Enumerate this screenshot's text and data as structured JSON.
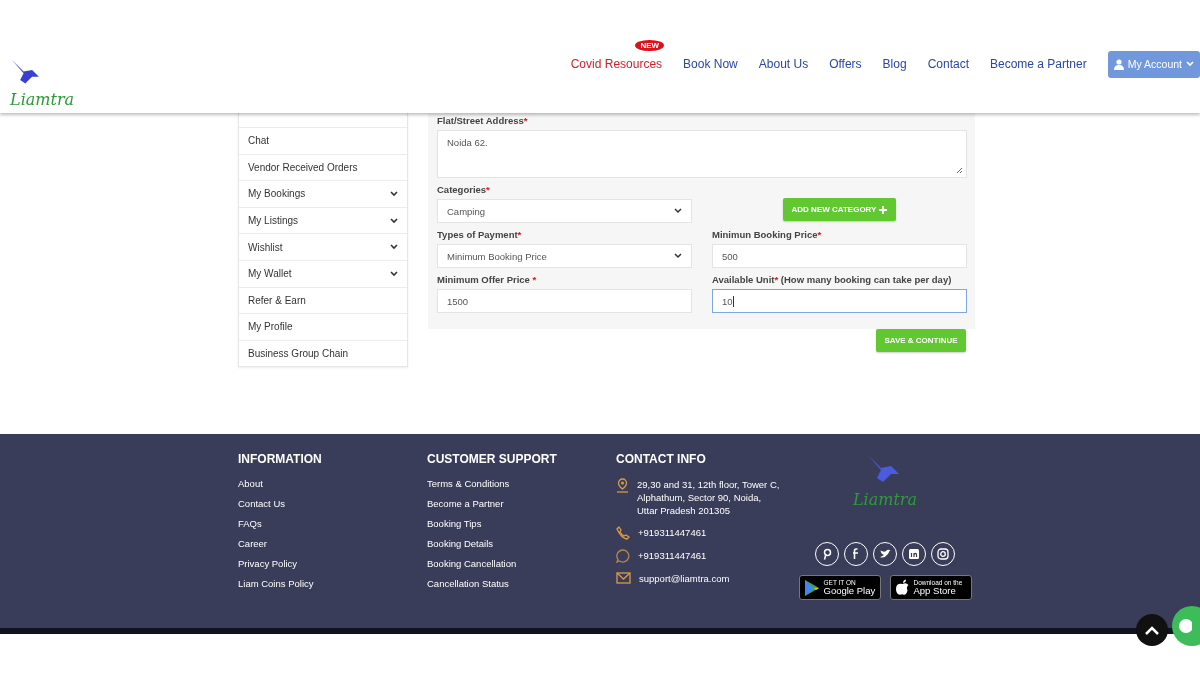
{
  "header": {
    "logo": "Liamtra",
    "nav": [
      {
        "label": "Covid Resources",
        "badge": "NEW",
        "kind": "highlight"
      },
      {
        "label": "Book Now",
        "kind": "link"
      },
      {
        "label": "About Us",
        "kind": "link"
      },
      {
        "label": "Offers",
        "kind": "link"
      },
      {
        "label": "Blog",
        "kind": "link"
      },
      {
        "label": "Contact",
        "kind": "link"
      },
      {
        "label": "Become a Partner",
        "kind": "link"
      }
    ],
    "account_button": "My Account"
  },
  "sidebar": {
    "items": [
      {
        "label": "Chat",
        "expandable": false
      },
      {
        "label": "Vendor Received Orders",
        "expandable": false
      },
      {
        "label": "My Bookings",
        "expandable": true
      },
      {
        "label": "My Listings",
        "expandable": true
      },
      {
        "label": "Wishlist",
        "expandable": true
      },
      {
        "label": "My Wallet",
        "expandable": true
      },
      {
        "label": "Refer & Earn",
        "expandable": false
      },
      {
        "label": "My Profile",
        "expandable": false
      },
      {
        "label": "Business Group Chain",
        "expandable": false
      }
    ]
  },
  "form": {
    "fields": [
      {
        "kind": "textarea",
        "label": "Flat/Street Address",
        "mark": "*",
        "value": "Noida 62.",
        "focused": false
      },
      {
        "kind": "select",
        "label": "Categories",
        "mark": "*",
        "value": "Camping",
        "focused": false
      },
      {
        "kind": "button",
        "label": "ADD NEW CATEGORY"
      },
      {
        "kind": "select",
        "label": "Types of Payment",
        "mark": "*",
        "value": "Minimum Booking Price",
        "focused": false
      },
      {
        "kind": "input",
        "label": "Minimun Booking Price",
        "mark": "*",
        "value": "500",
        "focused": false
      },
      {
        "kind": "input",
        "label": "Minimum Offer Price ",
        "mark": "*",
        "value": "1500",
        "focused": false
      },
      {
        "kind": "input",
        "label": "Available Unit",
        "mark": "*",
        "note": " (How many booking can take per day)",
        "value": "10",
        "focused": true
      }
    ],
    "save_button": "SAVE & CONTINUE"
  },
  "footer": {
    "columns": [
      {
        "title": "INFORMATION",
        "links": [
          "About",
          "Contact Us",
          "FAQs",
          "Career",
          "Privacy Policy",
          "Liam Coins Policy"
        ]
      },
      {
        "title": "CUSTOMER SUPPORT",
        "links": [
          "Terms & Conditions",
          "Become a Partner",
          "Booking Tips",
          "Booking Details",
          "Booking Cancellation",
          "Cancellation Status"
        ]
      }
    ],
    "contact": {
      "title": "CONTACT INFO",
      "items": [
        {
          "kind": "address",
          "text": "29,30 and 31, 12th floor, Tower C, Alphathum, Sector 90, Noida, Uttar Pradesh 201305"
        },
        {
          "kind": "phone",
          "text": "+919311447461"
        },
        {
          "kind": "whatsapp",
          "text": "+919311447461"
        },
        {
          "kind": "email",
          "text": "support@liamtra.com"
        }
      ]
    },
    "logo": "Liamtra",
    "socials": [
      {
        "kind": "pinterest"
      },
      {
        "kind": "facebook"
      },
      {
        "kind": "twitter"
      },
      {
        "kind": "linkedin"
      },
      {
        "kind": "instagram"
      }
    ],
    "stores": [
      {
        "kind": "google",
        "small": "GET IT ON",
        "big": "Google Play"
      },
      {
        "kind": "apple",
        "small": "Download on the",
        "big": "App Store"
      }
    ]
  }
}
